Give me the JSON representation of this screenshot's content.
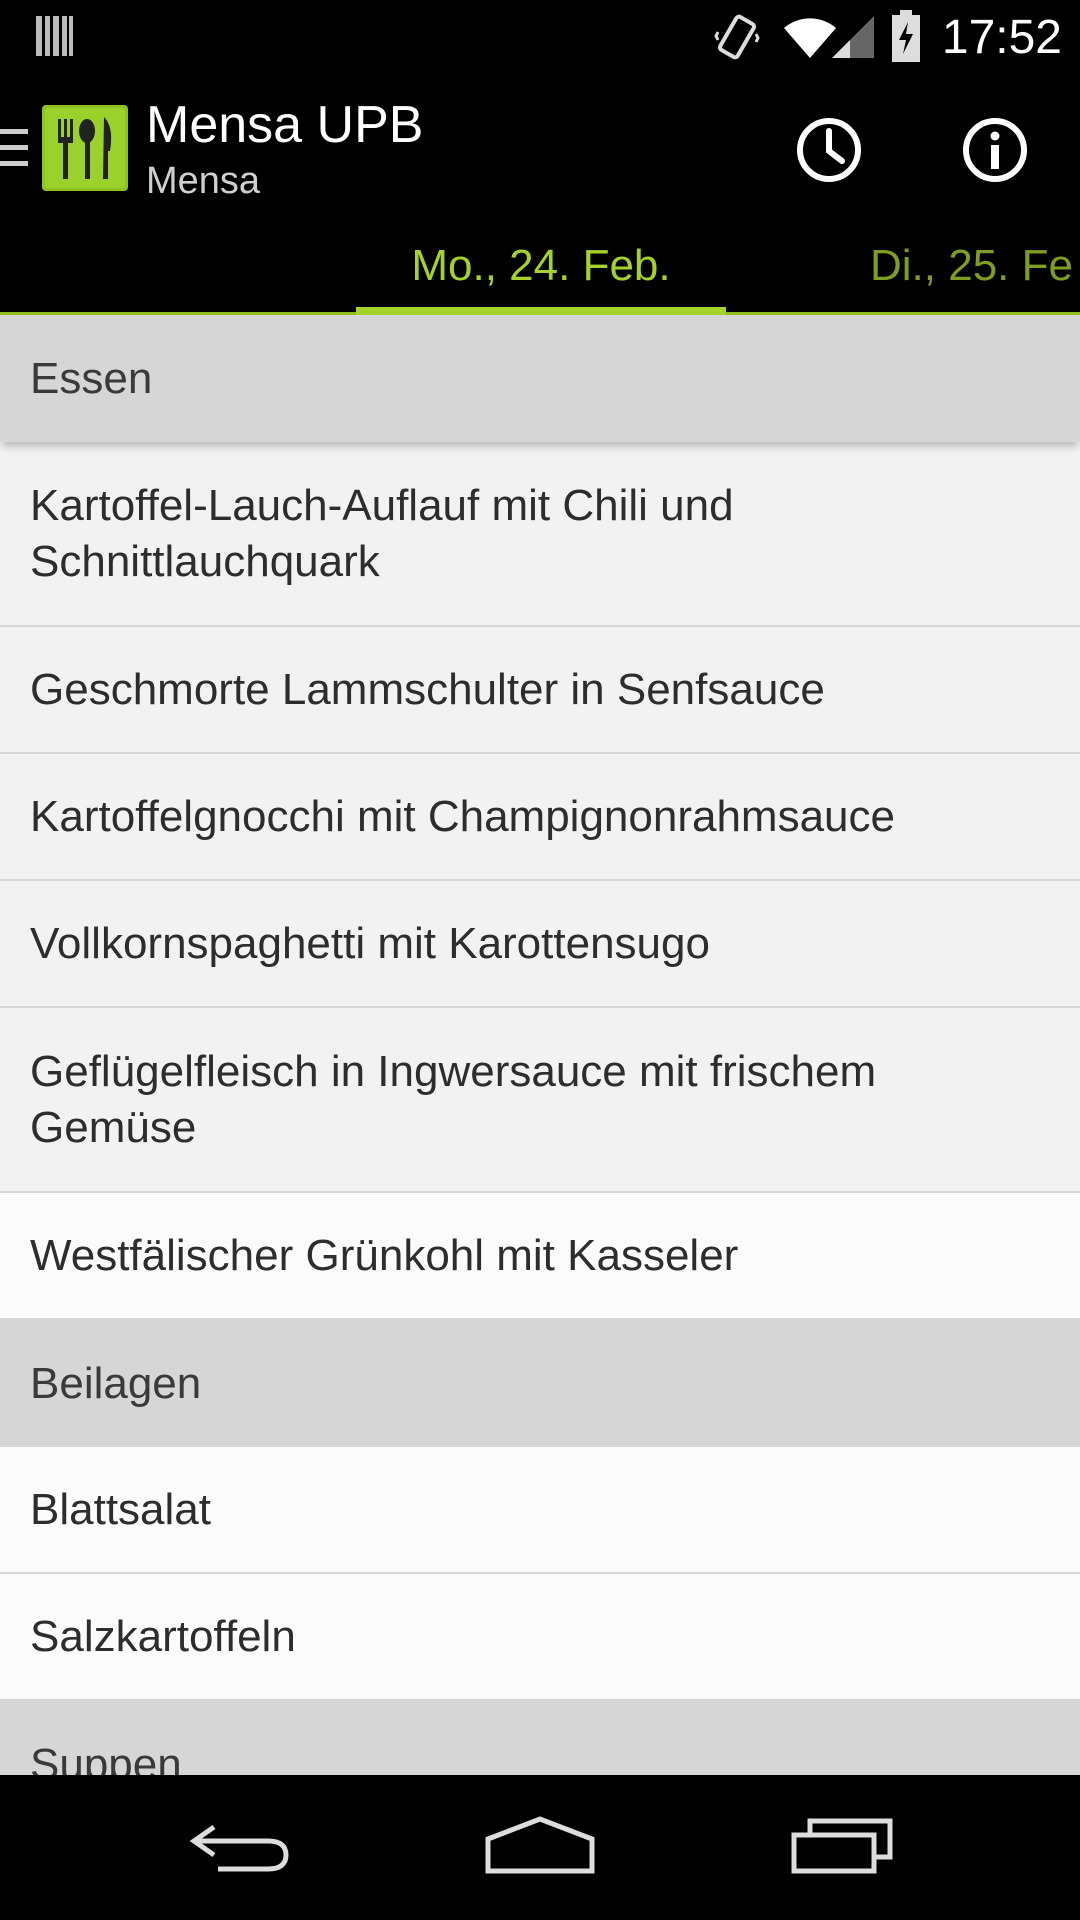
{
  "status_bar": {
    "time": "17:52",
    "icons": [
      "barcode-icon",
      "vibrate-icon",
      "wifi-icon",
      "signal-icon",
      "battery-charging-icon"
    ]
  },
  "action_bar": {
    "title": "Mensa UPB",
    "subtitle": "Mensa",
    "actions": [
      "clock-icon",
      "info-icon"
    ]
  },
  "tabs": [
    {
      "label": "Mo., 24. Feb.",
      "active": true
    },
    {
      "label": "Di., 25. Fe",
      "active": false
    }
  ],
  "menu": {
    "sections": [
      {
        "title": "Essen",
        "items": [
          "Kartoffel-Lauch-Auflauf mit Chili und Schnittlauchquark",
          "Geschmorte Lammschulter in Senfsauce",
          "Kartoffelgnocchi mit Champignonrahmsauce",
          "Vollkornspaghetti mit Karottensugo",
          "Geflügelfleisch in Ingwersauce mit frischem Gemüse",
          "Westfälischer Grünkohl mit Kasseler"
        ]
      },
      {
        "title": "Beilagen",
        "items": [
          "Blattsalat",
          "Salzkartoffeln"
        ]
      },
      {
        "title": "Suppen",
        "items": []
      }
    ]
  },
  "colors": {
    "accent": "#a4d12a",
    "header_bg": "#d6d6d6",
    "list_bg": "#f2f2f2"
  }
}
